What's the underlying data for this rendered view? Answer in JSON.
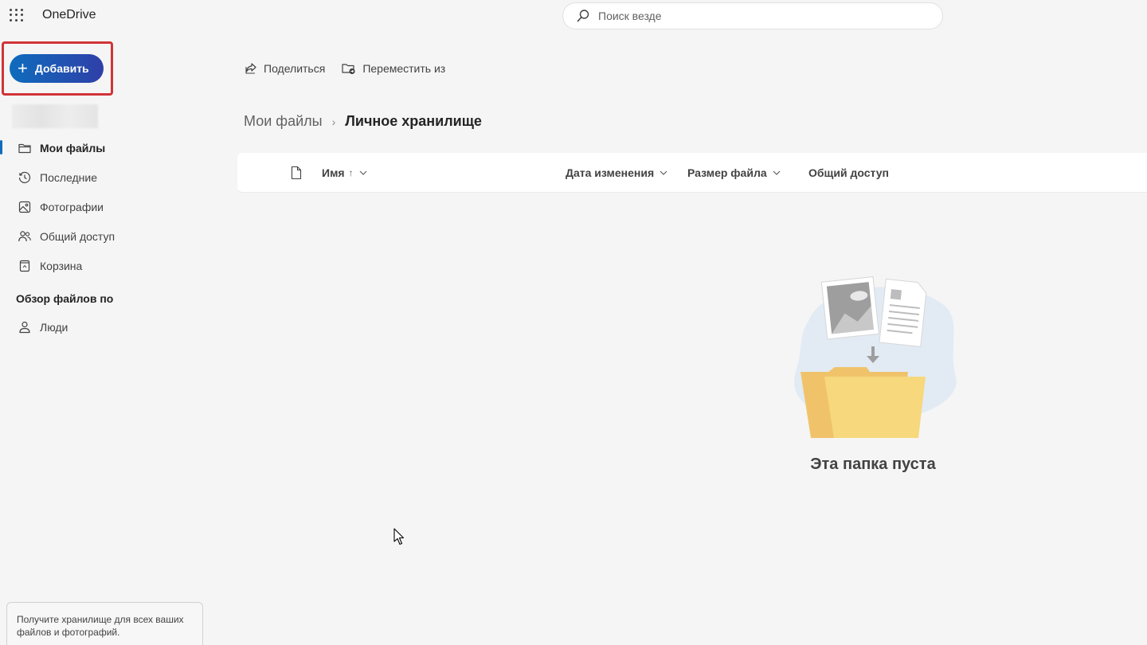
{
  "app": {
    "title": "OneDrive"
  },
  "search": {
    "placeholder": "Поиск везде"
  },
  "sidebar": {
    "add_button": "Добавить",
    "nav": [
      {
        "label": "Мои файлы",
        "icon": "folder-icon",
        "active": true
      },
      {
        "label": "Последние",
        "icon": "history-icon"
      },
      {
        "label": "Фотографии",
        "icon": "photo-icon"
      },
      {
        "label": "Общий доступ",
        "icon": "people-icon"
      },
      {
        "label": "Корзина",
        "icon": "recycle-bin-icon"
      }
    ],
    "browse_section": "Обзор файлов по",
    "browse_nav": [
      {
        "label": "Люди",
        "icon": "person-icon"
      }
    ],
    "promo": "Получите хранилище для всех ваших файлов и фотографий."
  },
  "commands": {
    "share": "Поделиться",
    "move_from": "Переместить из"
  },
  "breadcrumb": {
    "parent": "Мои файлы",
    "current": "Личное хранилище"
  },
  "columns": {
    "name": "Имя",
    "name_sort": "↑",
    "modified": "Дата изменения",
    "size": "Размер файла",
    "sharing": "Общий доступ"
  },
  "empty_state": {
    "message": "Эта папка пуста"
  },
  "colors": {
    "accent": "#0f6cbd",
    "highlight": "#d13438",
    "folder": "#f7d87c"
  }
}
